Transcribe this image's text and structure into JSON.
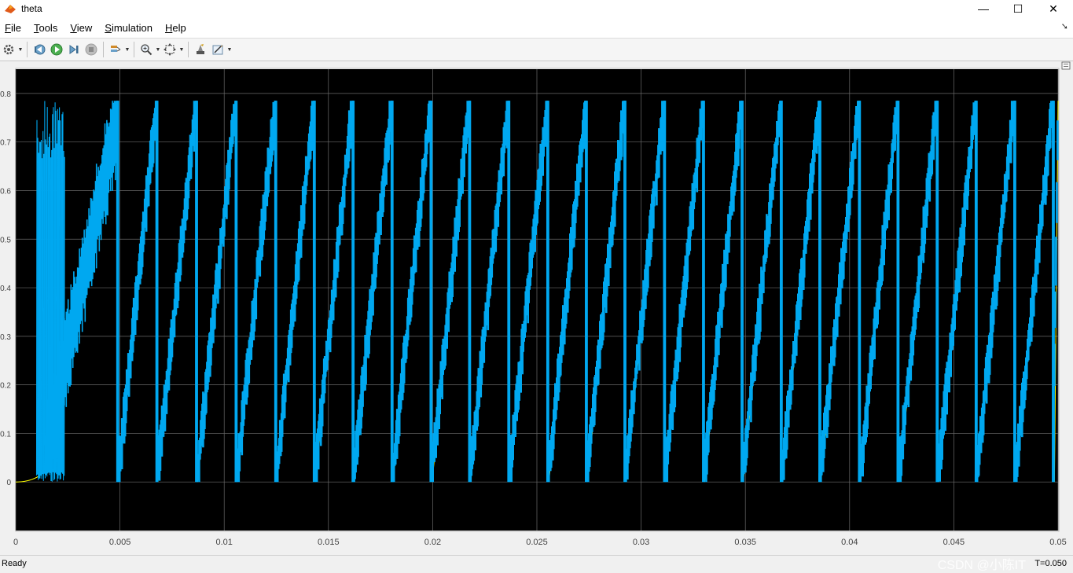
{
  "window": {
    "title": "theta",
    "minimize": "—",
    "maximize": "☐",
    "close": "✕"
  },
  "menu": [
    {
      "label": "File",
      "underline": "F",
      "rest": "ile"
    },
    {
      "label": "Tools",
      "underline": "T",
      "rest": "ools"
    },
    {
      "label": "View",
      "underline": "V",
      "rest": "iew"
    },
    {
      "label": "Simulation",
      "underline": "S",
      "rest": "imulation"
    },
    {
      "label": "Help",
      "underline": "H",
      "rest": "elp"
    }
  ],
  "toolbar": {
    "icons": [
      "settings-icon",
      "step-back-icon",
      "run-icon",
      "step-forward-icon",
      "stop-icon",
      "signal-selector-icon",
      "zoom-icon",
      "fit-to-view-icon",
      "highlight-icon",
      "properties-icon"
    ]
  },
  "colors": {
    "plot_bg": "#000000",
    "grid": "#6b6b6b",
    "series1": "#00a8f0",
    "series2": "#ffff00",
    "axis_text": "#444444"
  },
  "chart_data": {
    "type": "line",
    "xlim": [
      0,
      0.05
    ],
    "ylim": [
      -0.1,
      0.85
    ],
    "x_ticks": [
      "0",
      "0.005",
      "0.01",
      "0.015",
      "0.02",
      "0.025",
      "0.03",
      "0.035",
      "0.04",
      "0.045",
      "0.05"
    ],
    "y_ticks": [
      "0",
      "0.1",
      "0.2",
      "0.3",
      "0.4",
      "0.5",
      "0.6",
      "0.7",
      "0.8"
    ],
    "grid": true,
    "series": [
      {
        "color": "#00a8f0",
        "ramp_max": 0.785,
        "ramp_starts": [
          0.00487,
          0.00675,
          0.00865,
          0.01055,
          0.01245,
          0.0143,
          0.01616,
          0.01803,
          0.0199,
          0.02175,
          0.02363,
          0.0255,
          0.02735,
          0.0292,
          0.0311,
          0.03297,
          0.03482,
          0.0367,
          0.03855,
          0.04045,
          0.0423,
          0.04418,
          0.04605,
          0.0479,
          0.04975
        ]
      },
      {
        "color": "#ffff00",
        "ramp_max": 0.785
      }
    ]
  },
  "status": {
    "left": "Ready",
    "right": "T=0.050",
    "watermark": "CSDN @小陈IT"
  }
}
